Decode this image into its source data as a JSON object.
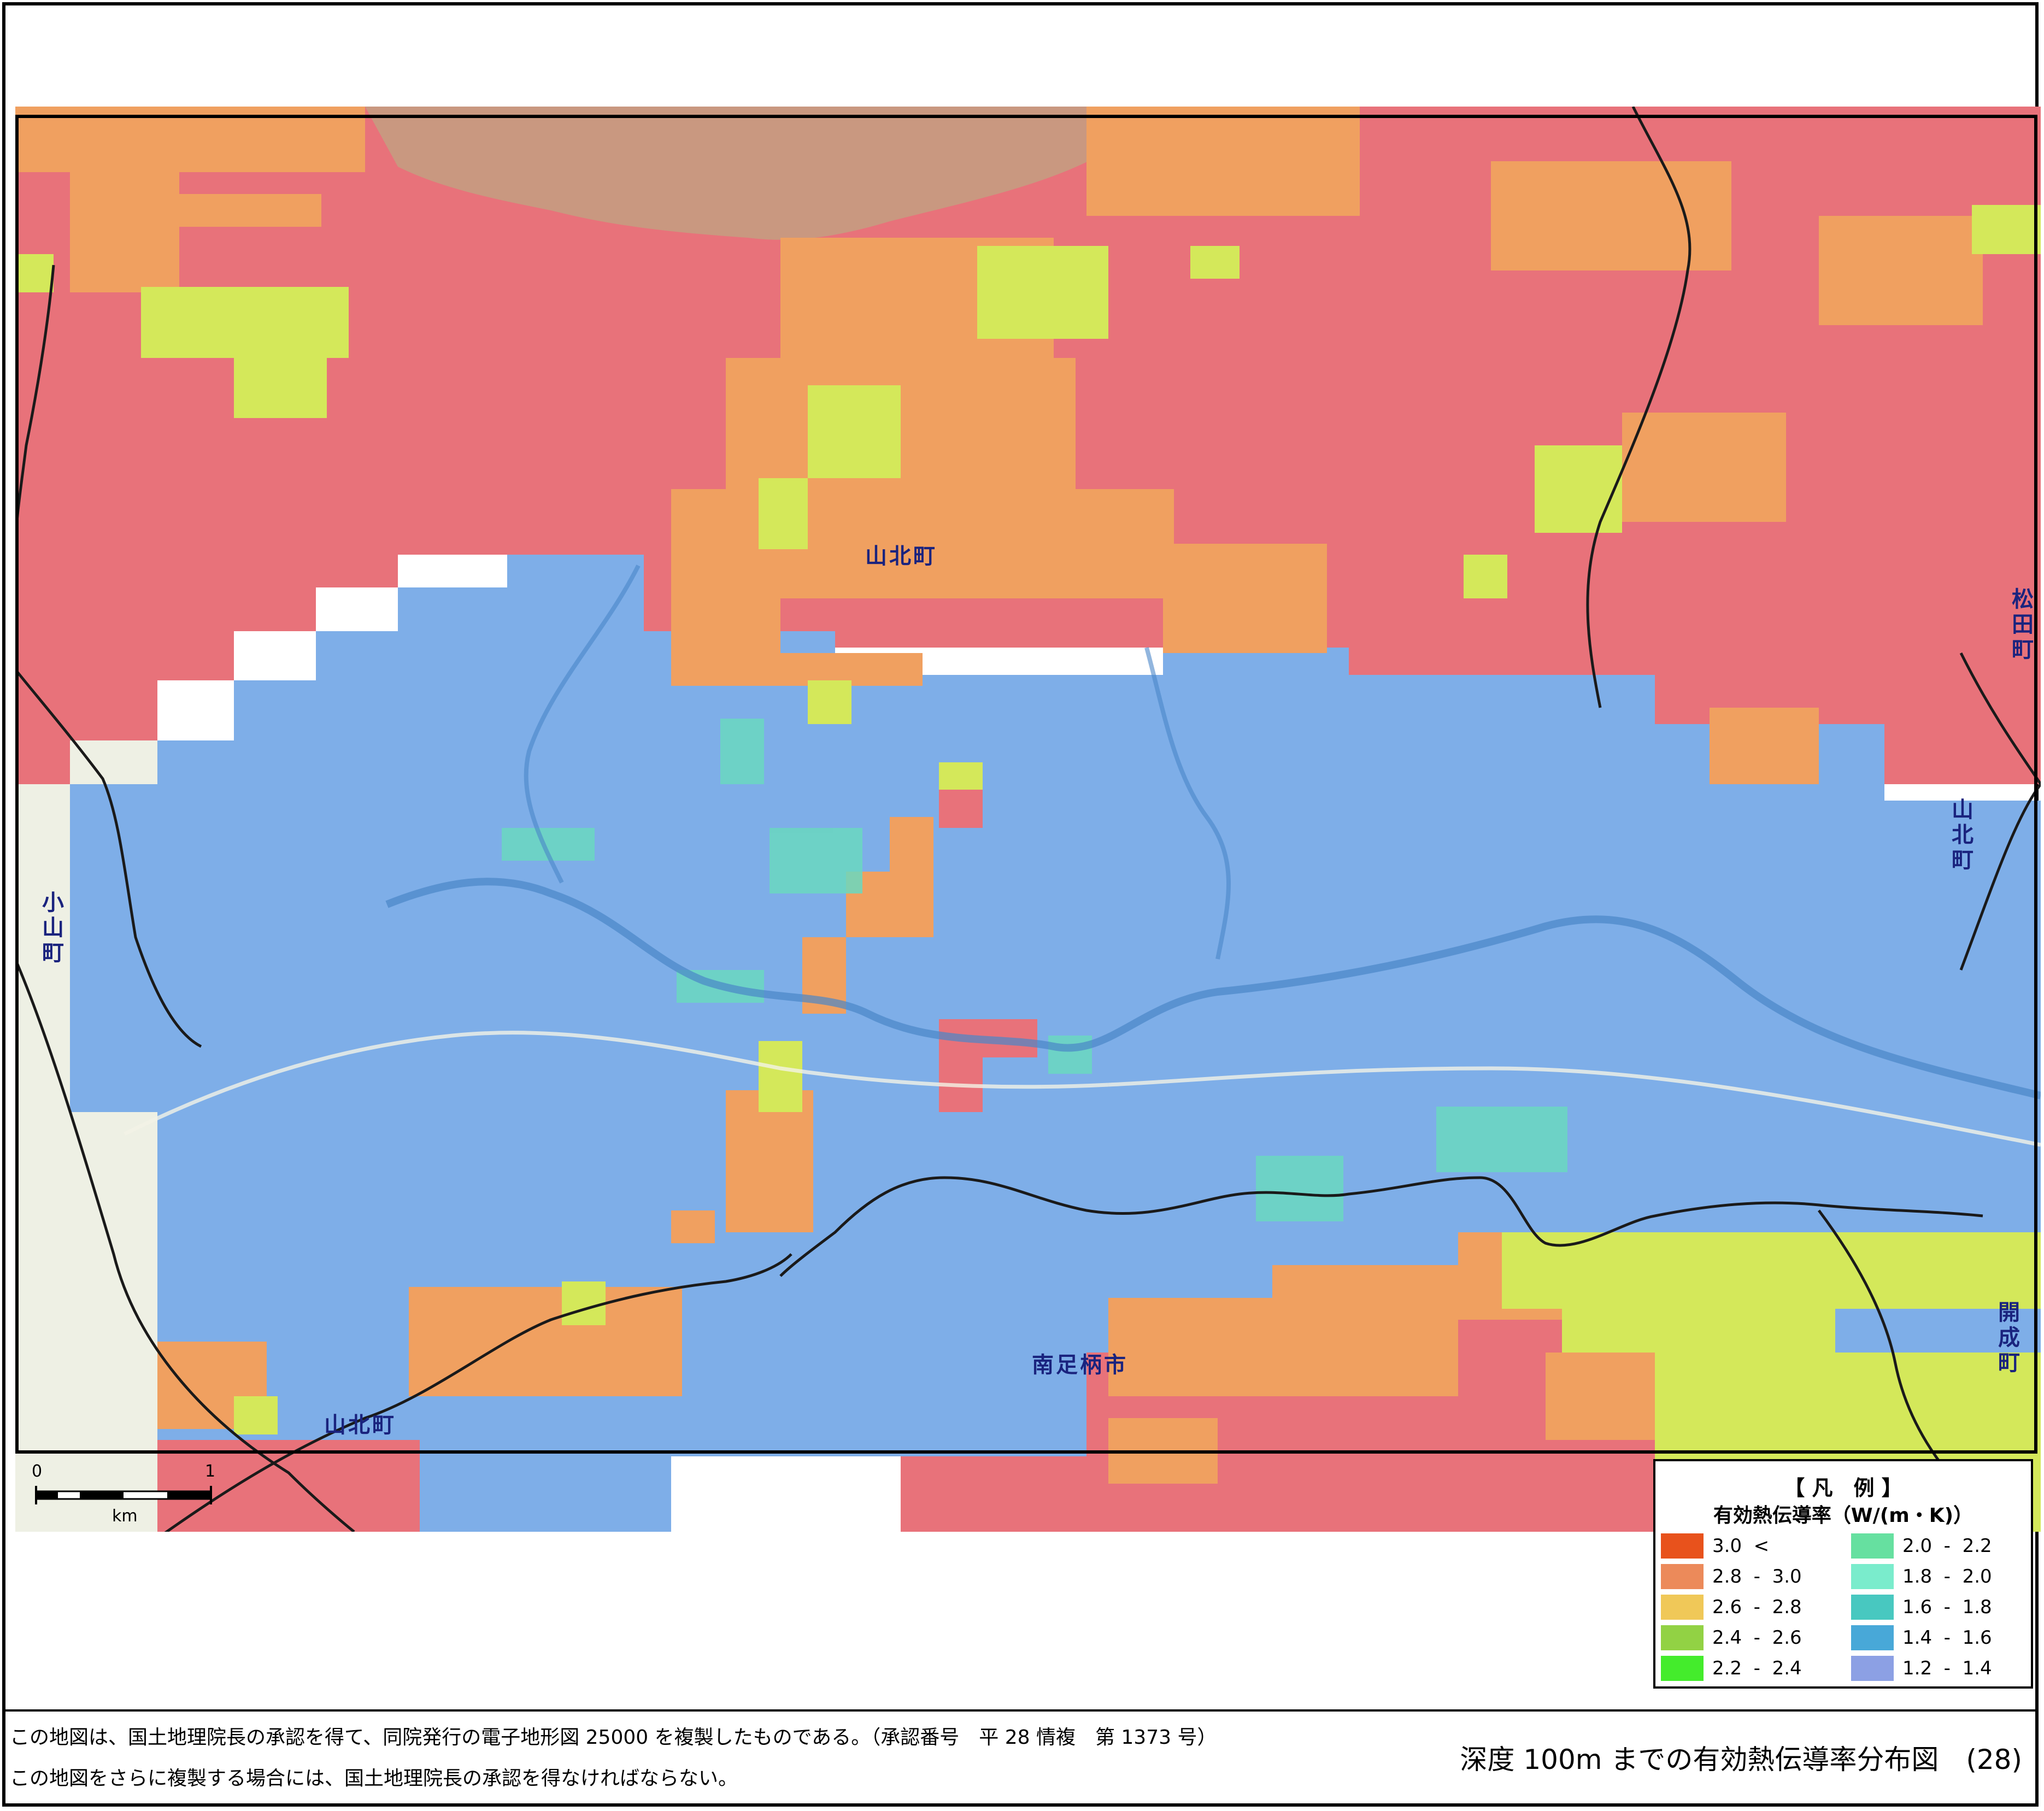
{
  "map": {
    "places": {
      "yamakita_center": "山北町",
      "yamakita_south": "山北町",
      "yamakita_east": "山北町",
      "minamiashigara": "南足柄市",
      "oyama": "小山町",
      "matsuda": "松田町",
      "kaisei": "開成町"
    },
    "colors": {
      "high": "#e8727a",
      "orange": "#f0a060",
      "yellow": "#d4e85a",
      "blue": "#7eaee8",
      "teal": "#6ad8c0",
      "lake": "#c99880",
      "outside": "#eef0e4"
    }
  },
  "scale": {
    "zero": "0",
    "one": "1",
    "unit": "km"
  },
  "legend": {
    "title": "【 凡　例 】",
    "subtitle": "有効熱伝導率（W/(m・K)）",
    "items": [
      {
        "label": "3.0  <",
        "color": "#e8521c"
      },
      {
        "label": "2.8  -  3.0",
        "color": "#ec8a5a"
      },
      {
        "label": "2.6  -  2.8",
        "color": "#f0c858"
      },
      {
        "label": "2.4  -  2.6",
        "color": "#92d244"
      },
      {
        "label": "2.2  -  2.4",
        "color": "#44ec2c"
      },
      {
        "label": "2.0  -  2.2",
        "color": "#66e0a0"
      },
      {
        "label": "1.8  -  2.0",
        "color": "#7aeccc"
      },
      {
        "label": "1.6  -  1.8",
        "color": "#48c8c0"
      },
      {
        "label": "1.4  -  1.6",
        "color": "#48a8d8"
      },
      {
        "label": "1.2  -  1.4",
        "color": "#8ca0e4"
      }
    ]
  },
  "footer": {
    "note1": "この地図は、国土地理院長の承認を得て、同院発行の電子地形図 25000 を複製したものである。（承認番号　平 28 情複　第 1373 号）",
    "note2": "この地図をさらに複製する場合には、国土地理院長の承認を得なければならない。",
    "title": "深度 100m までの有効熱伝導率分布図　(28)"
  }
}
